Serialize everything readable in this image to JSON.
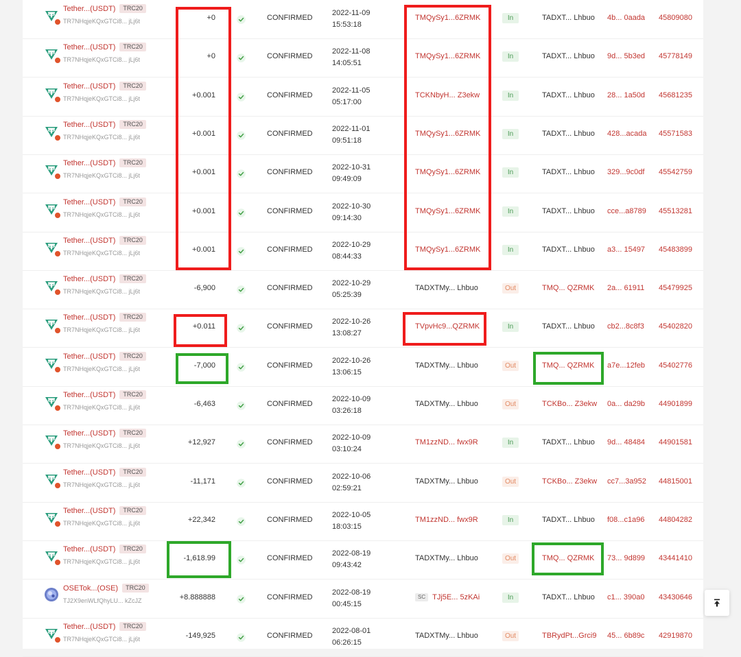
{
  "colors": {
    "link_red": "#c23631",
    "highlight_red": "#ef1c1c",
    "highlight_green": "#2ea82a",
    "in_badge": "#4a9a55",
    "out_badge": "#e28a63"
  },
  "scroll_top_icon": "arrow-up-to-top-icon",
  "rows": [
    {
      "token": "Tether...(USDT)",
      "standard": "TRC20",
      "token_addr": "TR7NHqjeKQxGTCi8... jLj6t",
      "icon": "tether-icon",
      "amount": "+0",
      "status": "CONFIRMED",
      "date": "2022-11-09",
      "time": "15:53:18",
      "from": "TMQySy1...6ZRMK",
      "from_sc": "",
      "direction": "In",
      "to": "TADXT... Lhbuo",
      "hash": "4b... 0aada",
      "block": "45809080"
    },
    {
      "token": "Tether...(USDT)",
      "standard": "TRC20",
      "token_addr": "TR7NHqjeKQxGTCi8... jLj6t",
      "icon": "tether-icon",
      "amount": "+0",
      "status": "CONFIRMED",
      "date": "2022-11-08",
      "time": "14:05:51",
      "from": "TMQySy1...6ZRMK",
      "from_sc": "",
      "direction": "In",
      "to": "TADXT... Lhbuo",
      "hash": "9d... 5b3ed",
      "block": "45778149"
    },
    {
      "token": "Tether...(USDT)",
      "standard": "TRC20",
      "token_addr": "TR7NHqjeKQxGTCi8... jLj6t",
      "icon": "tether-icon",
      "amount": "+0.001",
      "status": "CONFIRMED",
      "date": "2022-11-05",
      "time": "05:17:00",
      "from": "TCKNbyH... Z3ekw",
      "from_sc": "",
      "direction": "In",
      "to": "TADXT... Lhbuo",
      "hash": "28... 1a50d",
      "block": "45681235"
    },
    {
      "token": "Tether...(USDT)",
      "standard": "TRC20",
      "token_addr": "TR7NHqjeKQxGTCi8... jLj6t",
      "icon": "tether-icon",
      "amount": "+0.001",
      "status": "CONFIRMED",
      "date": "2022-11-01",
      "time": "09:51:18",
      "from": "TMQySy1...6ZRMK",
      "from_sc": "",
      "direction": "In",
      "to": "TADXT... Lhbuo",
      "hash": "428...acada",
      "block": "45571583"
    },
    {
      "token": "Tether...(USDT)",
      "standard": "TRC20",
      "token_addr": "TR7NHqjeKQxGTCi8... jLj6t",
      "icon": "tether-icon",
      "amount": "+0.001",
      "status": "CONFIRMED",
      "date": "2022-10-31",
      "time": "09:49:09",
      "from": "TMQySy1...6ZRMK",
      "from_sc": "",
      "direction": "In",
      "to": "TADXT... Lhbuo",
      "hash": "329...9c0df",
      "block": "45542759"
    },
    {
      "token": "Tether...(USDT)",
      "standard": "TRC20",
      "token_addr": "TR7NHqjeKQxGTCi8... jLj6t",
      "icon": "tether-icon",
      "amount": "+0.001",
      "status": "CONFIRMED",
      "date": "2022-10-30",
      "time": "09:14:30",
      "from": "TMQySy1...6ZRMK",
      "from_sc": "",
      "direction": "In",
      "to": "TADXT... Lhbuo",
      "hash": "cce...a8789",
      "block": "45513281"
    },
    {
      "token": "Tether...(USDT)",
      "standard": "TRC20",
      "token_addr": "TR7NHqjeKQxGTCi8... jLj6t",
      "icon": "tether-icon",
      "amount": "+0.001",
      "status": "CONFIRMED",
      "date": "2022-10-29",
      "time": "08:44:33",
      "from": "TMQySy1...6ZRMK",
      "from_sc": "",
      "direction": "In",
      "to": "TADXT... Lhbuo",
      "hash": "a3... 15497",
      "block": "45483899"
    },
    {
      "token": "Tether...(USDT)",
      "standard": "TRC20",
      "token_addr": "TR7NHqjeKQxGTCi8... jLj6t",
      "icon": "tether-icon",
      "amount": "-6,900",
      "status": "CONFIRMED",
      "date": "2022-10-29",
      "time": "05:25:39",
      "from": "TADXTMy... Lhbuo",
      "from_sc": "",
      "direction": "Out",
      "to": "TMQ... QZRMK",
      "hash": "2a... 61911",
      "block": "45479925"
    },
    {
      "token": "Tether...(USDT)",
      "standard": "TRC20",
      "token_addr": "TR7NHqjeKQxGTCi8... jLj6t",
      "icon": "tether-icon",
      "amount": "+0.011",
      "status": "CONFIRMED",
      "date": "2022-10-26",
      "time": "13:08:27",
      "from": "TVpvHc9...QZRMK",
      "from_sc": "",
      "direction": "In",
      "to": "TADXT... Lhbuo",
      "hash": "cb2...8c8f3",
      "block": "45402820"
    },
    {
      "token": "Tether...(USDT)",
      "standard": "TRC20",
      "token_addr": "TR7NHqjeKQxGTCi8... jLj6t",
      "icon": "tether-icon",
      "amount": "-7,000",
      "status": "CONFIRMED",
      "date": "2022-10-26",
      "time": "13:06:15",
      "from": "TADXTMy... Lhbuo",
      "from_sc": "",
      "direction": "Out",
      "to": "TMQ... QZRMK",
      "hash": "a7e...12feb",
      "block": "45402776"
    },
    {
      "token": "Tether...(USDT)",
      "standard": "TRC20",
      "token_addr": "TR7NHqjeKQxGTCi8... jLj6t",
      "icon": "tether-icon",
      "amount": "-6,463",
      "status": "CONFIRMED",
      "date": "2022-10-09",
      "time": "03:26:18",
      "from": "TADXTMy... Lhbuo",
      "from_sc": "",
      "direction": "Out",
      "to": "TCKBo... Z3ekw",
      "hash": "0a... da29b",
      "block": "44901899"
    },
    {
      "token": "Tether...(USDT)",
      "standard": "TRC20",
      "token_addr": "TR7NHqjeKQxGTCi8... jLj6t",
      "icon": "tether-icon",
      "amount": "+12,927",
      "status": "CONFIRMED",
      "date": "2022-10-09",
      "time": "03:10:24",
      "from": "TM1zzND... fwx9R",
      "from_sc": "",
      "direction": "In",
      "to": "TADXT... Lhbuo",
      "hash": "9d... 48484",
      "block": "44901581"
    },
    {
      "token": "Tether...(USDT)",
      "standard": "TRC20",
      "token_addr": "TR7NHqjeKQxGTCi8... jLj6t",
      "icon": "tether-icon",
      "amount": "-11,171",
      "status": "CONFIRMED",
      "date": "2022-10-06",
      "time": "02:59:21",
      "from": "TADXTMy... Lhbuo",
      "from_sc": "",
      "direction": "Out",
      "to": "TCKBo... Z3ekw",
      "hash": "cc7...3a952",
      "block": "44815001"
    },
    {
      "token": "Tether...(USDT)",
      "standard": "TRC20",
      "token_addr": "TR7NHqjeKQxGTCi8... jLj6t",
      "icon": "tether-icon",
      "amount": "+22,342",
      "status": "CONFIRMED",
      "date": "2022-10-05",
      "time": "18:03:15",
      "from": "TM1zzND... fwx9R",
      "from_sc": "",
      "direction": "In",
      "to": "TADXT... Lhbuo",
      "hash": "f08...c1a96",
      "block": "44804282"
    },
    {
      "token": "Tether...(USDT)",
      "standard": "TRC20",
      "token_addr": "TR7NHqjeKQxGTCi8... jLj6t",
      "icon": "tether-icon",
      "amount": "-1,618.99",
      "status": "CONFIRMED",
      "date": "2022-08-19",
      "time": "09:43:42",
      "from": "TADXTMy... Lhbuo",
      "from_sc": "",
      "direction": "Out",
      "to": "TMQ... QZRMK",
      "hash": "73... 9d899",
      "block": "43441410"
    },
    {
      "token": "OSETok...(OSE)",
      "standard": "TRC20",
      "token_addr": "TJ2X9enWLfQhyLU... kZcJZ",
      "icon": "ose-token-icon",
      "amount": "+8.888888",
      "status": "CONFIRMED",
      "date": "2022-08-19",
      "time": "00:45:15",
      "from": "TJj5E... 5zKAi",
      "from_sc": "SC",
      "direction": "In",
      "to": "TADXT... Lhbuo",
      "hash": "c1... 390a0",
      "block": "43430646"
    },
    {
      "token": "Tether...(USDT)",
      "standard": "TRC20",
      "token_addr": "TR7NHqjeKQxGTCi8... jLj6t",
      "icon": "tether-icon",
      "amount": "-149,925",
      "status": "CONFIRMED",
      "date": "2022-08-01",
      "time": "06:26:15",
      "from": "TADXTMy... Lhbuo",
      "from_sc": "",
      "direction": "Out",
      "to": "TBRydPt...Grci9",
      "hash": "45... 6b89c",
      "block": "42919870"
    }
  ]
}
